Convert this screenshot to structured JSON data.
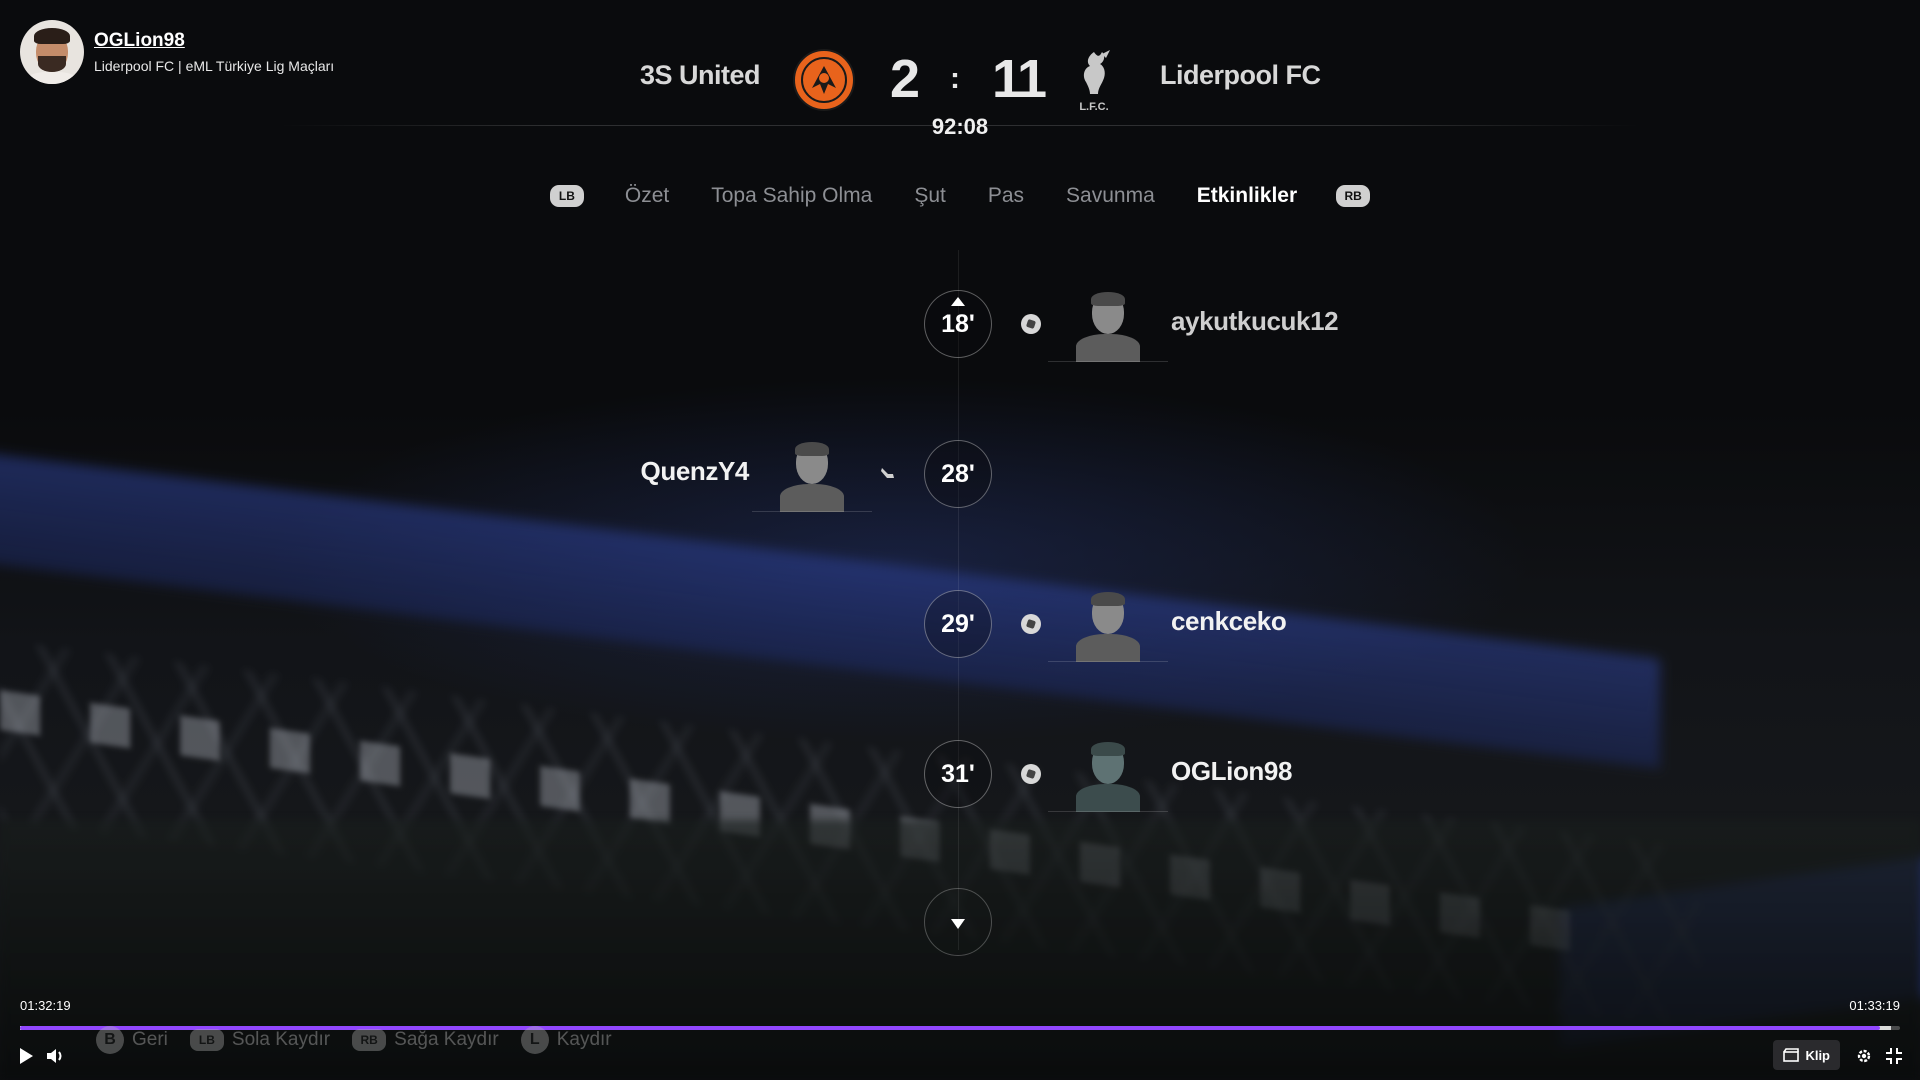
{
  "channel": {
    "name": "OGLion98",
    "title": "Liderpool FC | eML Türkiye Lig Maçları"
  },
  "match": {
    "home_team": "3S United",
    "away_team": "Liderpool FC",
    "home_score": "2",
    "separator": ":",
    "away_score": "11",
    "clock": "92:08",
    "away_crest_text": "L.F.C.",
    "colors": {
      "home_crest": "#e8631c",
      "accent": "#9147ff"
    }
  },
  "tabs": {
    "lb": "LB",
    "rb": "RB",
    "items": [
      {
        "label": "Özet",
        "active": false
      },
      {
        "label": "Topa Sahip Olma",
        "active": false
      },
      {
        "label": "Şut",
        "active": false
      },
      {
        "label": "Pas",
        "active": false
      },
      {
        "label": "Savunma",
        "active": false
      },
      {
        "label": "Etkinlikler",
        "active": true
      }
    ]
  },
  "events": [
    {
      "minute": "18'",
      "side": "away",
      "type": "goal",
      "player": "aykutkucuk12"
    },
    {
      "minute": "28'",
      "side": "home",
      "type": "assist",
      "player": "QuenzY4"
    },
    {
      "minute": "29'",
      "side": "away",
      "type": "goal",
      "player": "cenkceko"
    },
    {
      "minute": "31'",
      "side": "away",
      "type": "goal",
      "player": "OGLion98"
    }
  ],
  "hints": [
    {
      "button": "B",
      "label": "Geri"
    },
    {
      "button": "LB",
      "label": "Sola Kaydır"
    },
    {
      "button": "RB",
      "label": "Sağa Kaydır"
    },
    {
      "button": "L",
      "label": "Kaydır"
    }
  ],
  "player": {
    "current_time": "01:32:19",
    "end_time": "01:33:19",
    "progress": 0.9891,
    "buffered": 0.995,
    "clip_label": "Klip",
    "icons": [
      "play-icon",
      "volume-icon",
      "clip-icon",
      "settings-icon",
      "exit-fullscreen-icon"
    ]
  }
}
